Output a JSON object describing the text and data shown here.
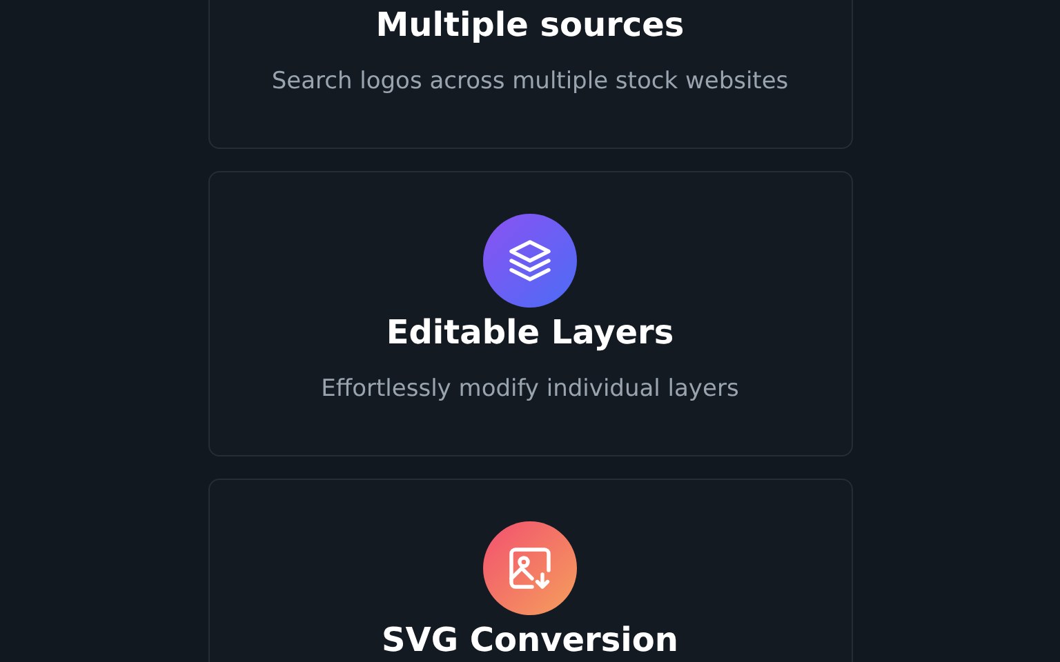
{
  "features": [
    {
      "title": "Multiple sources",
      "description": "Search logos across multiple stock websites"
    },
    {
      "kind": "layers",
      "title": "Editable Layers",
      "description": "Effortlessly modify individual layers"
    },
    {
      "kind": "image-download",
      "title": "SVG Conversion"
    }
  ]
}
